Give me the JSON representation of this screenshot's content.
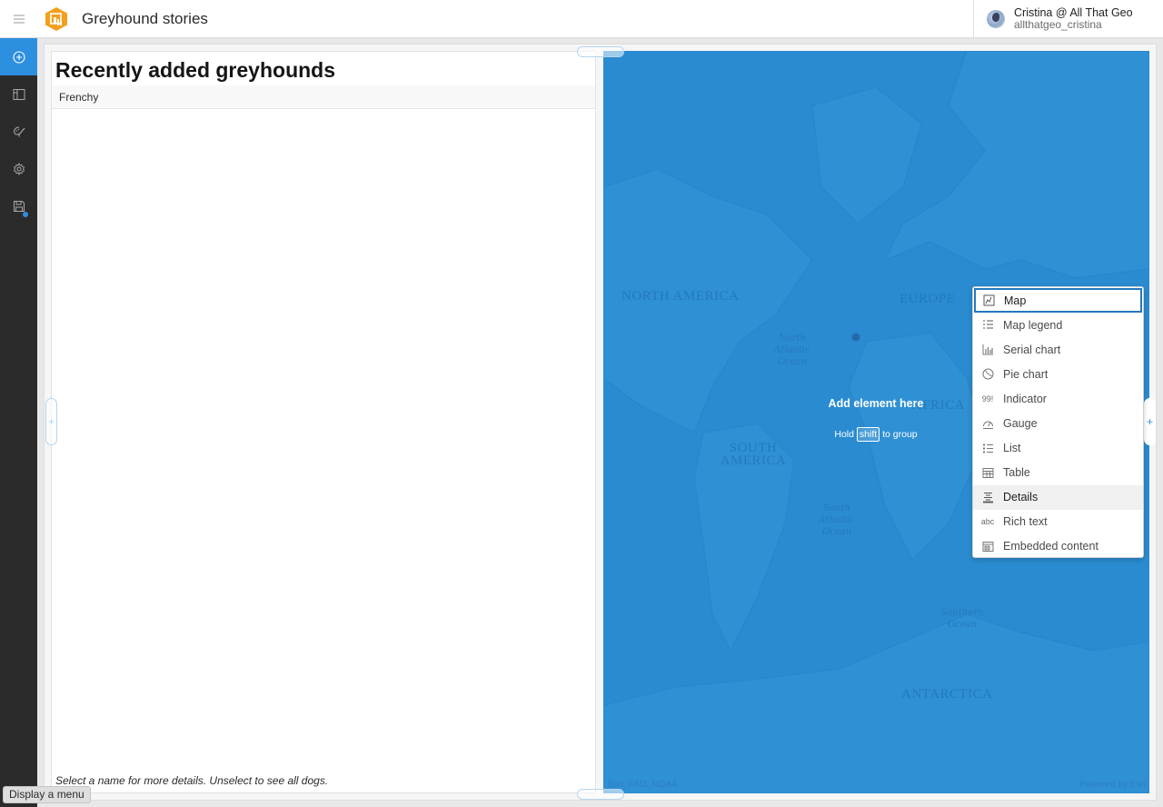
{
  "header": {
    "menu_icon": "hamburger-icon",
    "logo_icon": "dashboard-app-logo",
    "title": "Greyhound stories",
    "user": {
      "display_name": "Cristina @ All That Geo",
      "username": "allthatgeo_cristina"
    }
  },
  "actionbar": {
    "items": [
      {
        "name": "add-element",
        "icon": "plus-circle-icon",
        "active": true
      },
      {
        "name": "layout",
        "icon": "layout-icon",
        "active": false
      },
      {
        "name": "theme",
        "icon": "palette-brush-icon",
        "active": false
      },
      {
        "name": "settings",
        "icon": "gear-icon",
        "active": false
      },
      {
        "name": "save",
        "icon": "save-icon",
        "active": false,
        "has_unsaved_badge": true
      }
    ]
  },
  "list_panel": {
    "title": "Recently added greyhounds",
    "items": [
      "Frenchy"
    ],
    "footer": "Select a name for more details. Unselect to see all dogs."
  },
  "map": {
    "labels": {
      "north_america": "NORTH AMERICA",
      "europe": "EUROPE",
      "africa": "AFRICA",
      "south_america": "SOUTH AMERICA",
      "antarctica": "ANTARCTICA",
      "north_atlantic": "North Atlantic Ocean",
      "south_atlantic": "South Atlantic Ocean",
      "southern_ocean": "Southern Ocean"
    },
    "attribution": "Esri, FAO, NOAA",
    "powered_by": "Powered by Esri",
    "drop_hint": {
      "title": "Add element here",
      "hold": "Hold",
      "key": "shift",
      "suffix": "to group"
    }
  },
  "element_menu": {
    "items": [
      {
        "label": "Map",
        "icon": "map-icon",
        "state": "focused"
      },
      {
        "label": "Map legend",
        "icon": "legend-icon",
        "state": ""
      },
      {
        "label": "Serial chart",
        "icon": "serial-chart-icon",
        "state": ""
      },
      {
        "label": "Pie chart",
        "icon": "pie-chart-icon",
        "state": ""
      },
      {
        "label": "Indicator",
        "icon": "indicator-icon",
        "state": ""
      },
      {
        "label": "Gauge",
        "icon": "gauge-icon",
        "state": ""
      },
      {
        "label": "List",
        "icon": "list-icon",
        "state": ""
      },
      {
        "label": "Table",
        "icon": "table-icon",
        "state": ""
      },
      {
        "label": "Details",
        "icon": "details-icon",
        "state": "hover"
      },
      {
        "label": "Rich text",
        "icon": "rich-text-icon",
        "state": ""
      },
      {
        "label": "Embedded content",
        "icon": "embedded-content-icon",
        "state": ""
      }
    ],
    "indicator_glyph": "99!",
    "rich_text_glyph": "abc"
  },
  "tooltip": "Display a menu",
  "colors": {
    "accent": "#2d8fe0",
    "map_water": "#2a8bd1",
    "actionbar_bg": "#2b2b2b",
    "logo": "#f2a01f"
  }
}
